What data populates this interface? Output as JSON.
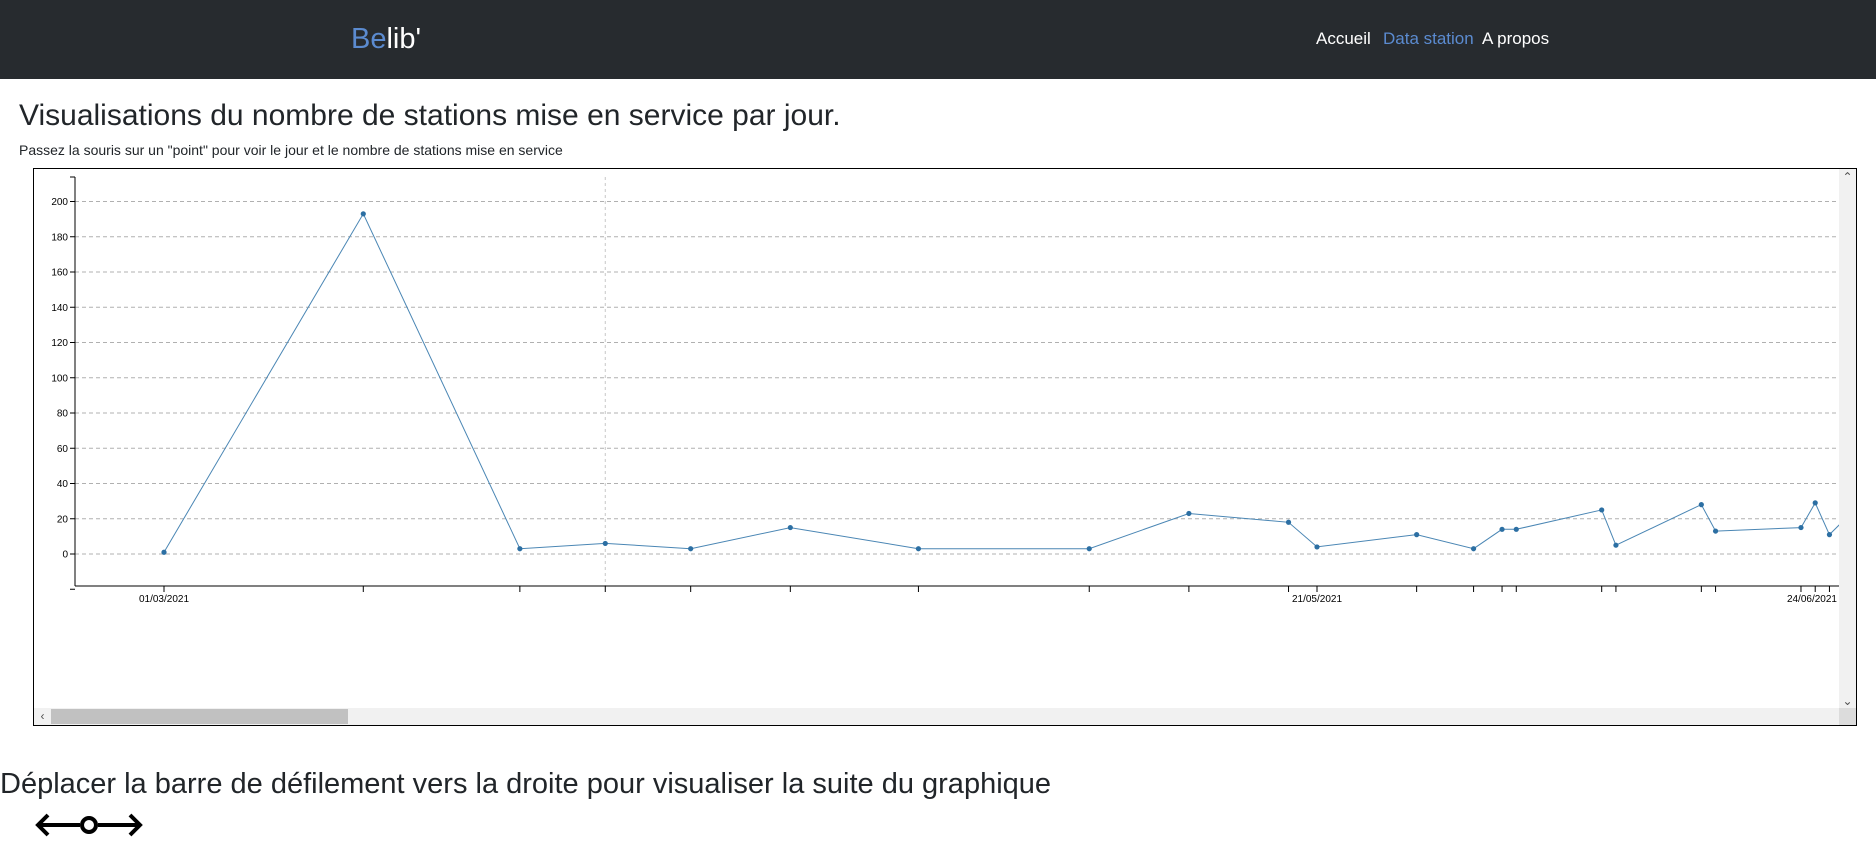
{
  "navbar": {
    "brand_prefix": "Be",
    "brand_suffix": "lib'",
    "links": [
      {
        "label": "Accueil",
        "active": false
      },
      {
        "label": "Data station",
        "active": true
      },
      {
        "label": "A propos",
        "active": false
      }
    ]
  },
  "main": {
    "title": "Visualisations du nombre de stations mise en service par jour.",
    "subtitle": "Passez la souris sur un \"point\" pour voir le jour et le nombre de stations mise en service",
    "scroll_hint": "Déplacer la barre de défilement vers la droite pour visualiser la suite du graphique"
  },
  "icons": {
    "scroll_left": "arrow-left-icon",
    "scroll_right": "arrow-right-icon",
    "scroll_up": "chevron-up-icon",
    "scroll_down": "chevron-down-icon",
    "drag": "horizontal-drag-icon"
  },
  "colors": {
    "navbar_bg": "#272b2f",
    "accent": "#5b8bd0",
    "line": "#4a86b4",
    "grid": "#b0b0b0"
  },
  "chart_data": {
    "type": "line",
    "title": "",
    "xlabel": "",
    "ylabel": "",
    "ylim": [
      -20,
      210
    ],
    "yticks": [
      0,
      20,
      40,
      60,
      80,
      100,
      120,
      140,
      160,
      180,
      200
    ],
    "grid": "horizontal dashed",
    "x_tick_labels": [
      "01/03/2021",
      "21/05/2021",
      "24/06/2021"
    ],
    "series": [
      {
        "name": "",
        "points": [
          {
            "x": "2021-03-01",
            "y": 1
          },
          {
            "x": "2021-03-15",
            "y": 193
          },
          {
            "x": "2021-03-26",
            "y": 3
          },
          {
            "x": "2021-04-01",
            "y": 6
          },
          {
            "x": "2021-04-07",
            "y": 3
          },
          {
            "x": "2021-04-14",
            "y": 15
          },
          {
            "x": "2021-04-23",
            "y": 3
          },
          {
            "x": "2021-05-05",
            "y": 3
          },
          {
            "x": "2021-05-12",
            "y": 23
          },
          {
            "x": "2021-05-19",
            "y": 18
          },
          {
            "x": "2021-05-21",
            "y": 4
          },
          {
            "x": "2021-05-28",
            "y": 11
          },
          {
            "x": "2021-06-01",
            "y": 3
          },
          {
            "x": "2021-06-03",
            "y": 14
          },
          {
            "x": "2021-06-04",
            "y": 14
          },
          {
            "x": "2021-06-10",
            "y": 25
          },
          {
            "x": "2021-06-11",
            "y": 5
          },
          {
            "x": "2021-06-17",
            "y": 28
          },
          {
            "x": "2021-06-18",
            "y": 13
          },
          {
            "x": "2021-06-24",
            "y": 15
          },
          {
            "x": "2021-06-25",
            "y": 29
          },
          {
            "x": "2021-06-26",
            "y": 11
          },
          {
            "x": "2021-06-27",
            "y": 19
          }
        ]
      }
    ]
  }
}
